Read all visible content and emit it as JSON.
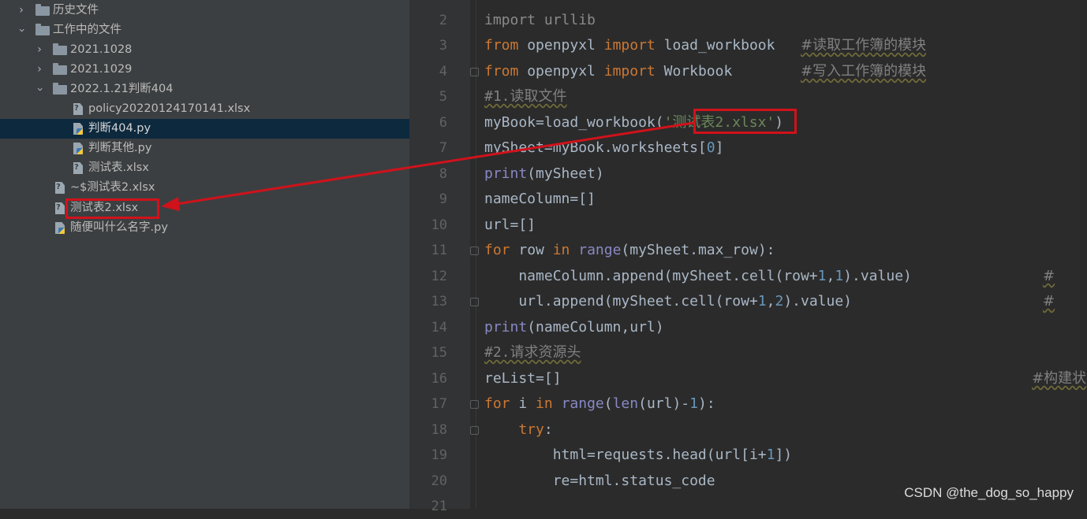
{
  "file_tree": {
    "items": [
      {
        "label": "历史文件",
        "type": "folder"
      },
      {
        "label": "工作中的文件",
        "type": "folder"
      },
      {
        "label": "2021.1028",
        "type": "folder"
      },
      {
        "label": "2021.1029",
        "type": "folder"
      },
      {
        "label": "2022.1.21判断404",
        "type": "folder"
      },
      {
        "label": "policy20220124170141.xlsx",
        "type": "unknown-file"
      },
      {
        "label": "判断404.py",
        "type": "python-file"
      },
      {
        "label": "判断其他.py",
        "type": "python-file"
      },
      {
        "label": "测试表.xlsx",
        "type": "unknown-file"
      },
      {
        "label": "~$测试表2.xlsx",
        "type": "unknown-file"
      },
      {
        "label": "测试表2.xlsx",
        "type": "unknown-file"
      },
      {
        "label": "随便叫什么名字.py",
        "type": "python-file"
      }
    ]
  },
  "editor": {
    "line_numbers": [
      "2",
      "3",
      "4",
      "5",
      "6",
      "7",
      "8",
      "9",
      "10",
      "11",
      "12",
      "13",
      "14",
      "15",
      "16",
      "17",
      "18",
      "19",
      "20",
      "21"
    ],
    "lines": {
      "l2": {
        "t1": "import urllib"
      },
      "l3": {
        "kw1": "from",
        "t1": " openpyxl ",
        "kw2": "import",
        "t2": " load_workbook   ",
        "cmt": "#读取工作簿的模块"
      },
      "l4": {
        "kw1": "from",
        "t1": " openpyxl ",
        "kw2": "import",
        "t2": " Workbook        ",
        "cmt": "#写入工作簿的模块"
      },
      "l5": {
        "cmt": "#1.读取文件"
      },
      "l6": {
        "t1": "myBook=load_workbook(",
        "str": "'测试表2.xlsx'",
        "t2": ")"
      },
      "l7": {
        "t1": "mySheet=myBook.worksheets[",
        "num": "0",
        "t2": "]"
      },
      "l8": {
        "bi": "print",
        "t1": "(mySheet)"
      },
      "l9": {
        "t1": "nameColumn=[]"
      },
      "l10": {
        "t1": "url=[]"
      },
      "l11": {
        "kw1": "for",
        "t1": " row ",
        "kw2": "in",
        "t2": " ",
        "bi": "range",
        "t3": "(mySheet.max_row):"
      },
      "l12": {
        "t1": "    nameColumn.append(mySheet.cell(row+",
        "n1": "1",
        "t2": ",",
        "n2": "1",
        "t3": ").value)",
        "cmt": "#"
      },
      "l13": {
        "t1": "    url.append(mySheet.cell(row+",
        "n1": "1",
        "t2": ",",
        "n2": "2",
        "t3": ").value)",
        "cmt": "#"
      },
      "l14": {
        "bi": "print",
        "t1": "(nameColumn,url)"
      },
      "l15": {
        "cmt": "#2.请求资源头"
      },
      "l16": {
        "t1": "reList=[]",
        "cmt": "#构建状"
      },
      "l17": {
        "kw1": "for",
        "t1": " i ",
        "kw2": "in",
        "t2": " ",
        "bi1": "range",
        "t3": "(",
        "bi2": "len",
        "t4": "(url)-",
        "num": "1",
        "t5": "):"
      },
      "l18": {
        "kw1": "    try",
        "t1": ":"
      },
      "l19": {
        "t1": "        html=requests.head(url[i+",
        "num": "1",
        "t2": "])"
      },
      "l20": {
        "t1": "        re=html.status_code"
      }
    }
  },
  "watermark": "CSDN @the_dog_so_happy",
  "colors": {
    "highlight_box": "#d0121b",
    "selected_row": "#0d293e",
    "keyword": "#cc7832",
    "builtin": "#8888c6",
    "number": "#6897bb",
    "string": "#6a8759",
    "comment": "#808080"
  }
}
